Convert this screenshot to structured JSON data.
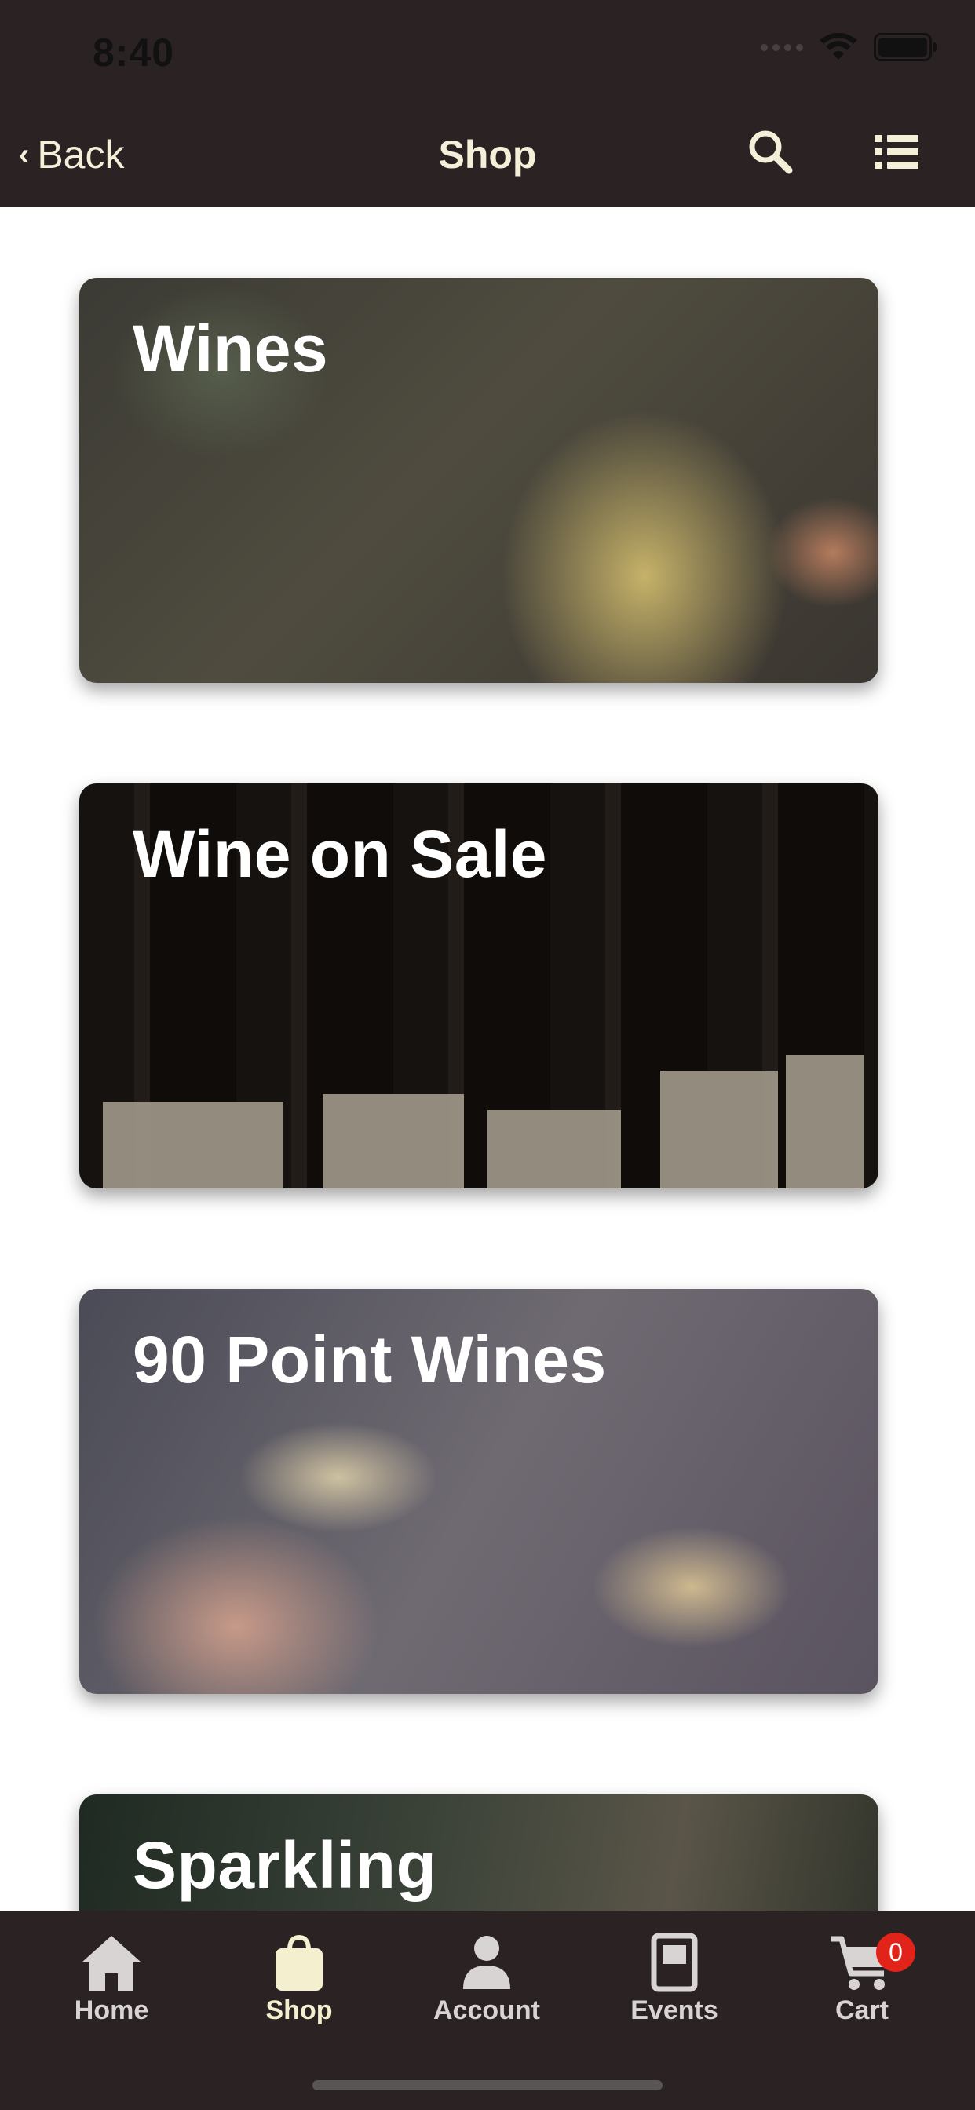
{
  "status_bar": {
    "time": "8:40"
  },
  "nav": {
    "back_label": "Back",
    "title": "Shop",
    "icons": [
      "search-icon",
      "list-icon"
    ]
  },
  "cards": [
    {
      "title": "Wines"
    },
    {
      "title": "Wine on Sale"
    },
    {
      "title": "90 Point Wines"
    },
    {
      "title": "Sparkling"
    }
  ],
  "tab_bar": {
    "tabs": [
      {
        "label": "Home",
        "icon": "home-icon"
      },
      {
        "label": "Shop",
        "icon": "shopping-bag-icon",
        "active": true
      },
      {
        "label": "Account",
        "icon": "person-icon"
      },
      {
        "label": "Events",
        "icon": "calendar-icon"
      },
      {
        "label": "Cart",
        "icon": "cart-icon",
        "badge": "0"
      }
    ]
  },
  "colors": {
    "bar_background": "#2b2323",
    "accent": "#f3efcf",
    "badge": "#e2231a"
  }
}
